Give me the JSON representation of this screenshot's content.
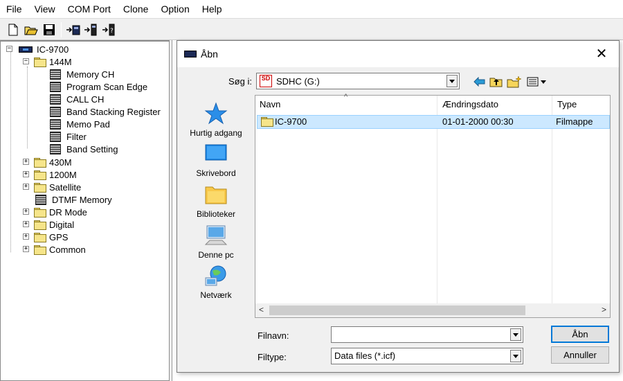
{
  "menu": [
    "File",
    "View",
    "COM Port",
    "Clone",
    "Option",
    "Help"
  ],
  "tree": {
    "root": "IC-9700",
    "band_144": "144M",
    "children_144": [
      "Memory CH",
      "Program Scan Edge",
      "CALL CH",
      "Band Stacking Register",
      "Memo Pad",
      "Filter",
      "Band Setting"
    ],
    "others": [
      "430M",
      "1200M",
      "Satellite",
      "DTMF Memory",
      "DR Mode",
      "Digital",
      "GPS",
      "Common"
    ]
  },
  "dialog": {
    "title": "Åbn",
    "look_in_label": "Søg i:",
    "location": "SDHC (G:)",
    "sd_badge": "SD",
    "places": [
      "Hurtig adgang",
      "Skrivebord",
      "Biblioteker",
      "Denne pc",
      "Netværk"
    ],
    "columns": [
      "Navn",
      "Ændringsdato",
      "Type"
    ],
    "rows": [
      {
        "name": "IC-9700",
        "date": "01-01-2000 00:30",
        "type": "Filmappe"
      }
    ],
    "filename_label": "Filnavn:",
    "filename_value": "",
    "filetype_label": "Filtype:",
    "filetype_value": "Data files (*.icf)",
    "open_button": "Åbn",
    "cancel_button": "Annuller"
  },
  "colors": {
    "selection": "#cce8ff",
    "folder": "#f6e58a",
    "accent": "#0078d7"
  }
}
